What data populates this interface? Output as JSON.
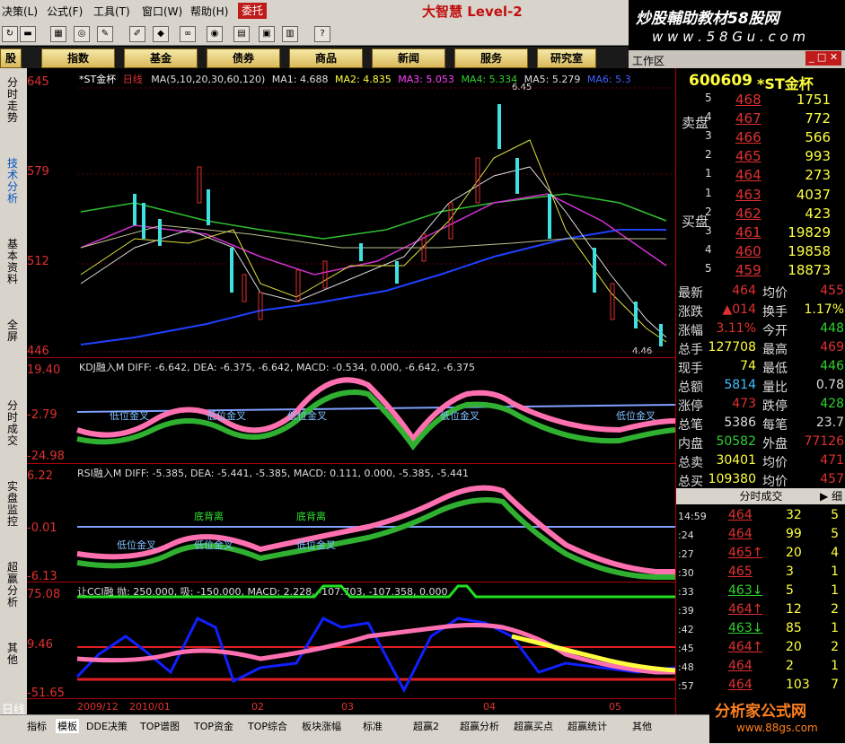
{
  "menu": [
    "决策(L)",
    "公式(F)",
    "工具(T)",
    "窗口(W)",
    "帮助(H)"
  ],
  "menu_button": "委托",
  "brand": "大智慧 Level-2",
  "watermark_top": "炒股輔助教材58股网",
  "watermark_top_url": "w w w . 5 8 G u . c o m",
  "nav_buttons": [
    "股",
    "指数",
    "基金",
    "债券",
    "商品",
    "新闻",
    "服务",
    "研究室"
  ],
  "workspace_label": "工作区",
  "left_tabs": [
    "分时走势",
    "技术分析",
    "基本资料",
    "全屏",
    "分时成交",
    "实盘监控",
    "超赢分析",
    "其他"
  ],
  "chart": {
    "title": "*ST金杯",
    "period": "日线",
    "ma_legend": "MA(5,10,20,30,60,120)",
    "ma_values": [
      "MA1: 4.688",
      "MA2: 4.835",
      "MA3: 5.053",
      "MA4: 5.334",
      "MA5: 5.279",
      "MA6: 5.3"
    ],
    "price_labels": [
      "645",
      "579",
      "512",
      "446"
    ],
    "high_label": "6.45",
    "low_label": "4.46",
    "kdj_legend": "KDJ融入M DIFF: -6.642, DEA: -6.375, -6.642, MACD: -0.534, 0.000, -6.642, -6.375",
    "kdj_labels": [
      "19.40",
      "-2.79",
      "-24.98"
    ],
    "kdj_signals": [
      "低位金叉",
      "低位金叉",
      "低位金叉",
      "低位金叉",
      "低位金叉"
    ],
    "rsi_legend": "RSI融入M DIFF: -5.385, DEA: -5.441, -5.385, MACD: 0.111, 0.000, -5.385, -5.441",
    "rsi_labels": [
      "6.22",
      "-0.01",
      "-6.13"
    ],
    "rsi_signals": [
      "低位金叉",
      "低位金叉",
      "低位金叉"
    ],
    "rsi_top": [
      "底背离",
      "底背离"
    ],
    "cci_legend": "让CCI融 抛: 250.000, 吸: -150.000, MACD: 2.228, -107.703, -107.358, 0.000",
    "cci_labels": [
      "75.08",
      "9.46",
      "-51.65"
    ],
    "date_labels": [
      "2009/12",
      "2010/01",
      "02",
      "03",
      "04",
      "05"
    ],
    "period_label": "日线"
  },
  "quote": {
    "code": "600609",
    "name": "*ST金杯",
    "sell_label": "卖盘",
    "buy_label": "买盘",
    "sells": [
      {
        "lvl": "5",
        "px": "468",
        "vol": "1751"
      },
      {
        "lvl": "4",
        "px": "467",
        "vol": "772"
      },
      {
        "lvl": "3",
        "px": "466",
        "vol": "566"
      },
      {
        "lvl": "2",
        "px": "465",
        "vol": "993"
      },
      {
        "lvl": "1",
        "px": "464",
        "vol": "273"
      }
    ],
    "buys": [
      {
        "lvl": "1",
        "px": "463",
        "vol": "4037"
      },
      {
        "lvl": "2",
        "px": "462",
        "vol": "423"
      },
      {
        "lvl": "3",
        "px": "461",
        "vol": "19829"
      },
      {
        "lvl": "4",
        "px": "460",
        "vol": "19858"
      },
      {
        "lvl": "5",
        "px": "459",
        "vol": "18873"
      }
    ],
    "stats": [
      {
        "l": "最新",
        "v": "464",
        "c": "#e03030",
        "l2": "均价",
        "v2": "455",
        "c2": "#e03030"
      },
      {
        "l": "涨跌",
        "v": "▲014",
        "c": "#e03030",
        "l2": "换手",
        "v2": "1.17%",
        "c2": "#ffff40"
      },
      {
        "l": "涨幅",
        "v": "3.11%",
        "c": "#e03030",
        "l2": "今开",
        "v2": "448",
        "c2": "#30d030"
      },
      {
        "l": "总手",
        "v": "127708",
        "c": "#ffff40",
        "l2": "最高",
        "v2": "469",
        "c2": "#e03030"
      },
      {
        "l": "现手",
        "v": "74",
        "c": "#ffff40",
        "l2": "最低",
        "v2": "446",
        "c2": "#30d030"
      },
      {
        "l": "总额",
        "v": "5814",
        "c": "#40c0ff",
        "l2": "量比",
        "v2": "0.78",
        "c2": "#ddd"
      },
      {
        "l": "涨停",
        "v": "473",
        "c": "#e03030",
        "l2": "跌停",
        "v2": "428",
        "c2": "#30d030"
      },
      {
        "l": "总笔",
        "v": "5386",
        "c": "#ddd",
        "l2": "每笔",
        "v2": "23.7",
        "c2": "#ddd"
      },
      {
        "l": "内盘",
        "v": "50582",
        "c": "#30d030",
        "l2": "外盘",
        "v2": "77126",
        "c2": "#e03030"
      },
      {
        "l": "总卖",
        "v": "30401",
        "c": "#ffff40",
        "l2": "均价",
        "v2": "471",
        "c2": "#e03030"
      },
      {
        "l": "总买",
        "v": "109380",
        "c": "#ffff40",
        "l2": "均价",
        "v2": "457",
        "c2": "#e03030"
      }
    ],
    "tick_title": "分时成交",
    "tick_title_btn": "▶ 细",
    "ticks": [
      {
        "t": "14:59",
        "p": "464",
        "v": "32",
        "n": "5"
      },
      {
        "t": ":24",
        "p": "464",
        "v": "99",
        "n": "5"
      },
      {
        "t": ":27",
        "p": "465↑",
        "v": "20",
        "n": "4"
      },
      {
        "t": ":30",
        "p": "465",
        "v": "3",
        "n": "1"
      },
      {
        "t": ":33",
        "p": "463↓",
        "v": "5",
        "n": "1"
      },
      {
        "t": ":39",
        "p": "464↑",
        "v": "12",
        "n": "2"
      },
      {
        "t": ":42",
        "p": "463↓",
        "v": "85",
        "n": "1"
      },
      {
        "t": ":45",
        "p": "464↑",
        "v": "20",
        "n": "2"
      },
      {
        "t": ":48",
        "p": "464",
        "v": "2",
        "n": "1"
      },
      {
        "t": ":57",
        "p": "464",
        "v": "103",
        "n": "7"
      }
    ]
  },
  "bottom_tabs": [
    "指标",
    "模板",
    "DDE决策",
    "TOP谱图",
    "TOP资金",
    "TOP综合",
    "板块涨幅",
    "标准",
    "超赢2",
    "超赢分析",
    "超赢买点",
    "超赢统计",
    "其他"
  ],
  "watermark_bottom": "分析家公式网",
  "watermark_bottom_url": "www.88gs.com",
  "colors": {
    "up": "#e03030",
    "down": "#30d030",
    "accent": "#ffff40"
  }
}
